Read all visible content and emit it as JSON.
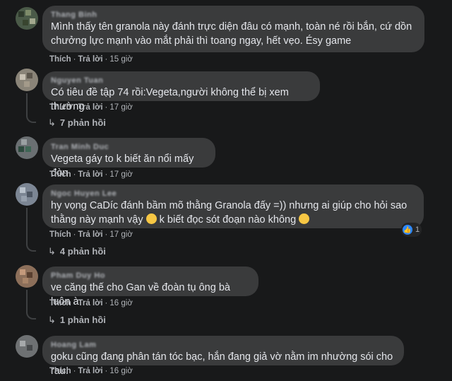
{
  "labels": {
    "like": "Thích",
    "reply": "Trả lời",
    "like_icon": "👍",
    "reply_arrow": "↳"
  },
  "comments": [
    {
      "author": "Thang Binh",
      "text": "Mình thấy tên granola này đánh trực diện đâu có mạnh, toàn né rồi bắn, cứ dồn chưởng lực mạnh vào mắt phải thì toang ngay, hết vẹo. Ésy game",
      "time": "15 giờ"
    },
    {
      "author": "Nguyen Tuan",
      "text": "Có tiêu đề tập 74 rồi:Vegeta,người không thể bị xem thường",
      "time": "17 giờ",
      "replies": "7 phản hồi"
    },
    {
      "author": "Tran Minh Duc",
      "text": "Vegeta gáy to k biết ăn nổi mấy đòn",
      "time": "17 giờ"
    },
    {
      "author": "Ngoc Huyen Lee",
      "text_part1": "hy vọng CaDíc đánh bầm mõ thằng Granola đấy =)) nhưng ai giúp cho hỏi sao thằng này mạnh vậy ",
      "text_part2": " k biết đọc sót đoạn nào không ",
      "time": "17 giờ",
      "reaction_count": "1",
      "replies": "4 phản hồi"
    },
    {
      "author": "Pham Duy Ho",
      "text": "ve căng thế cho Gan về đoàn tụ ông bà luôn à",
      "time": "16 giờ",
      "replies": "1 phản hồi"
    },
    {
      "author": "Hoang Lam",
      "text": "goku cũng đang phân tán tóc bạc, hắn đang giả vờ nằm im nhường sói cho rau.",
      "time": "16 giờ"
    }
  ]
}
